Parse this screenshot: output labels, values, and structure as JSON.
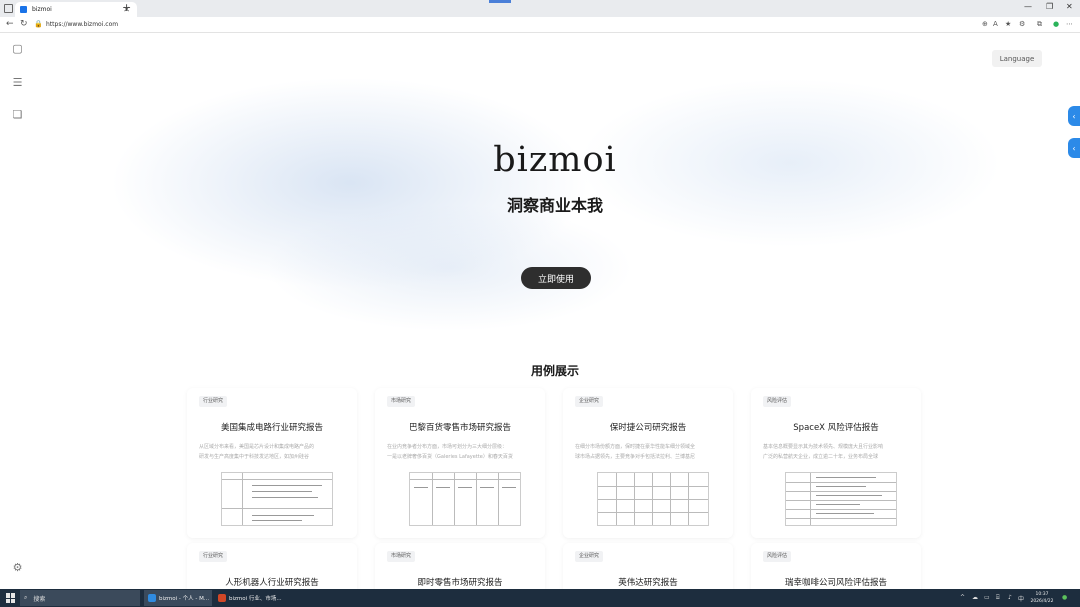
{
  "browser": {
    "tab_title": "bizmoi",
    "url": "https://www.bizmoi.com",
    "new_tab_symbol": "+"
  },
  "hero": {
    "language_label": "Language",
    "brand": "bizmoi",
    "tagline": "洞察商业本我",
    "cta_label": "立即使用"
  },
  "showcase": {
    "title": "用例展示",
    "cards": [
      {
        "tag": "行业研究",
        "title": "美国集成电路行业研究报告",
        "desc1": "从区域分布来看，美国是芯片设计和集成电路产品的",
        "desc2": "研发与生产高度集中于科技发达地区，如加州硅谷"
      },
      {
        "tag": "市场研究",
        "title": "巴黎百货零售市场研究报告",
        "desc1": "在业内竞争者分布方面，市场可划分为三大细分层级：",
        "desc2": "一是以老牌奢侈百货（Galeries Lafayette）和春天百货"
      },
      {
        "tag": "企业研究",
        "title": "保时捷公司研究报告",
        "desc1": "在细分市场份额方面，保时捷在豪华性能车细分领域全",
        "desc2": "球市场占据领先，主要竞争对手包括法拉利、兰博基尼"
      },
      {
        "tag": "风险评估",
        "title": "SpaceX 风险评估报告",
        "desc1": "基本信息概要显示其为技术领先、规模庞大且行业影响",
        "desc2": "广泛的私营航天企业，成立逾二十年，业务布局全球"
      },
      {
        "tag": "行业研究",
        "title": "人形机器人行业研究报告"
      },
      {
        "tag": "市场研究",
        "title": "即时零售市场研究报告"
      },
      {
        "tag": "企业研究",
        "title": "英伟达研究报告"
      },
      {
        "tag": "风险评估",
        "title": "瑞幸咖啡公司风险评估报告"
      }
    ]
  },
  "taskbar": {
    "search_label": "搜索",
    "items": [
      {
        "label": "bizmoi - 个人 - M...",
        "color": "#2f8be0"
      },
      {
        "label": "bizmoi 行业、市场...",
        "color": "#d24726"
      }
    ],
    "time": "10:37",
    "date": "2026/4/22"
  },
  "colors": {
    "accent": "#2c8ae8",
    "cta_bg": "#2e2e2e",
    "taskbar_bg": "#1d2d3e"
  }
}
